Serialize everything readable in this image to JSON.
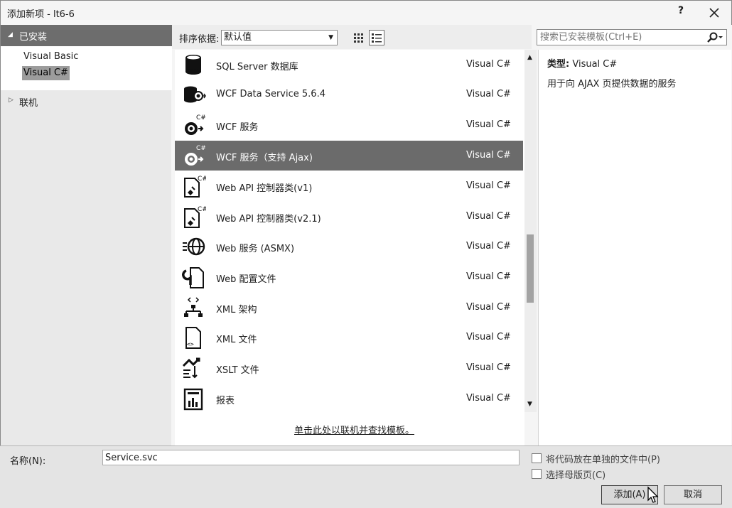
{
  "window": {
    "title": "添加新项 - lt6-6",
    "help_label": "?"
  },
  "tree": {
    "installed_label": "已安装",
    "items": [
      {
        "label": "Visual Basic",
        "selected": false
      },
      {
        "label": "Visual C#",
        "selected": true
      }
    ],
    "online_label": "联机"
  },
  "toolbar": {
    "sort_label": "排序依据:",
    "sort_value": "默认值",
    "view_mode": "list"
  },
  "search": {
    "placeholder": "搜索已安装模板(Ctrl+E)"
  },
  "templates": [
    {
      "name": "SQL Server 数据库",
      "lang": "Visual C#",
      "icon": "database-icon",
      "selected": false
    },
    {
      "name": "WCF Data Service 5.6.4",
      "lang": "Visual C#",
      "icon": "data-service-icon",
      "selected": false
    },
    {
      "name": "WCF 服务",
      "lang": "Visual C#",
      "icon": "wcf-service-icon",
      "selected": false
    },
    {
      "name": "WCF 服务（支持 Ajax)",
      "lang": "Visual C#",
      "icon": "wcf-ajax-service-icon",
      "selected": true
    },
    {
      "name": "Web API 控制器类(v1)",
      "lang": "Visual C#",
      "icon": "web-api-controller-icon",
      "selected": false
    },
    {
      "name": "Web API 控制器类(v2.1)",
      "lang": "Visual C#",
      "icon": "web-api-controller-icon",
      "selected": false
    },
    {
      "name": "Web 服务 (ASMX)",
      "lang": "Visual C#",
      "icon": "globe-icon",
      "selected": false
    },
    {
      "name": "Web 配置文件",
      "lang": "Visual C#",
      "icon": "config-file-icon",
      "selected": false
    },
    {
      "name": "XML 架构",
      "lang": "Visual C#",
      "icon": "xml-schema-icon",
      "selected": false
    },
    {
      "name": "XML 文件",
      "lang": "Visual C#",
      "icon": "xml-file-icon",
      "selected": false
    },
    {
      "name": "XSLT 文件",
      "lang": "Visual C#",
      "icon": "xslt-file-icon",
      "selected": false
    },
    {
      "name": "报表",
      "lang": "Visual C#",
      "icon": "report-icon",
      "selected": false
    }
  ],
  "online_link": "单击此处以联机并查找模板。",
  "details": {
    "type_label": "类型:",
    "type_value": "Visual C#",
    "description": "用于向 AJAX 页提供数据的服务"
  },
  "bottom": {
    "name_label": "名称(N):",
    "name_value": "Service.svc",
    "checkbox1_label": "将代码放在单独的文件中(P)",
    "checkbox1_checked": false,
    "checkbox2_label": "选择母版页(C)",
    "checkbox2_checked": false,
    "add_label": "添加(A)",
    "cancel_label": "取消"
  },
  "colors": {
    "selection": "#6b6b6b",
    "header": "#6d6d6d",
    "background": "#f5f5f5"
  }
}
